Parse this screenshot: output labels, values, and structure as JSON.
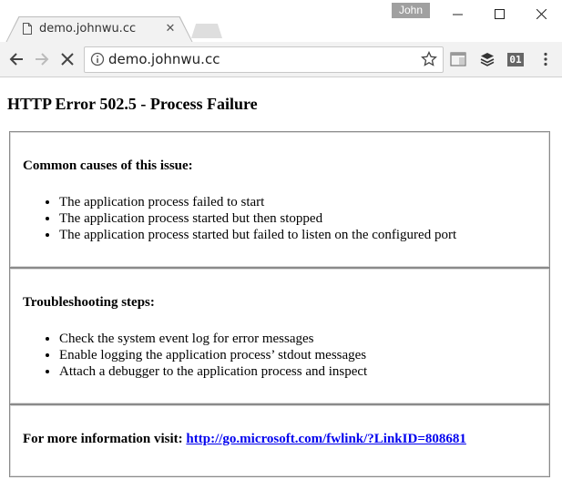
{
  "browser": {
    "tab": {
      "title": "demo.johnwu.cc",
      "close_glyph": "✕"
    },
    "profile_name": "John",
    "window_controls": {
      "minimize": "—",
      "maximize": "☐",
      "close": "✕"
    },
    "address_bar": {
      "url": "demo.johnwu.cc"
    },
    "extensions": {
      "ext_01_label": "01"
    }
  },
  "page": {
    "title": "HTTP Error 502.5 - Process Failure",
    "causes": {
      "heading": "Common causes of this issue:",
      "items": [
        "The application process failed to start",
        "The application process started but then stopped",
        "The application process started but failed to listen on the configured port"
      ]
    },
    "troubleshooting": {
      "heading": "Troubleshooting steps:",
      "items": [
        "Check the system event log for error messages",
        "Enable logging the application process’ stdout messages",
        "Attach a debugger to the application process and inspect"
      ]
    },
    "more_info": {
      "label": "For more information visit:",
      "link_text": "http://go.microsoft.com/fwlink/?LinkID=808681"
    }
  },
  "colors": {
    "link": "#0000ee",
    "toolbar_bg": "#f2f2f2",
    "profile_bg": "#a0a0a0"
  }
}
